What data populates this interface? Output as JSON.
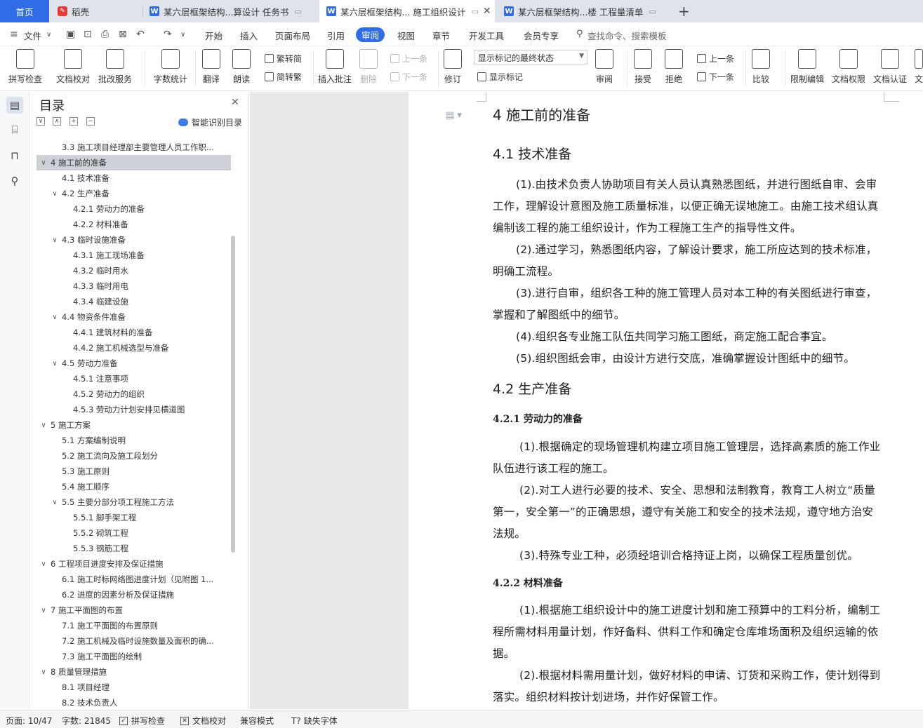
{
  "tabs": {
    "home": "首页",
    "daoke": "稻壳",
    "doc1": "某六层框架结构...算设计 任务书",
    "doc2": "某六层框架结构... 施工组织设计",
    "doc3": "某六层框架结构...楼 工程量清单"
  },
  "menu": {
    "file": "文件",
    "items": [
      "开始",
      "插入",
      "页面布局",
      "引用",
      "审阅",
      "视图",
      "章节",
      "开发工具",
      "会员专享"
    ],
    "active": "审阅",
    "search": "查找命令、搜索模板"
  },
  "ribbon": {
    "spell": "拼写检查",
    "doccheck": "文档校对",
    "batch": "批改服务",
    "wordcount": "字数统计",
    "translate": "翻译",
    "read": "朗读",
    "trad": "繁转简",
    "simp": "简转繁",
    "insert_comment": "插入批注",
    "delete": "删除",
    "prev": "上一条",
    "next": "下一条",
    "track": "修订",
    "markup_select": "显示标记的最终状态",
    "show_markup": "显示标记",
    "review": "审阅",
    "accept": "接受",
    "reject": "拒绝",
    "prev2": "上一条",
    "next2": "下一条",
    "compare": "比较",
    "restrict": "限制编辑",
    "permission": "文档权限",
    "certify": "文档认证",
    "cut": "文"
  },
  "toc": {
    "title": "目录",
    "smart": "智能识别目录",
    "items": [
      {
        "label": "3.3  施工项目经理部主要管理人员工作职...",
        "level": 2,
        "arrow": ""
      },
      {
        "label": "4 施工前的准备",
        "level": 1,
        "arrow": "v",
        "selected": true
      },
      {
        "label": "4.1 技术准备",
        "level": 2,
        "arrow": ""
      },
      {
        "label": "4.2 生产准备",
        "level": 2,
        "arrow": "v"
      },
      {
        "label": "4.2.1 劳动力的准备",
        "level": 3,
        "arrow": ""
      },
      {
        "label": "4.2.2 材料准备",
        "level": 3,
        "arrow": ""
      },
      {
        "label": "4.3  临时设施准备",
        "level": 2,
        "arrow": "v"
      },
      {
        "label": "4.3.1 施工现场准备",
        "level": 3,
        "arrow": ""
      },
      {
        "label": "4.3.2 临时用水",
        "level": 3,
        "arrow": ""
      },
      {
        "label": "4.3.3  临时用电",
        "level": 3,
        "arrow": ""
      },
      {
        "label": "4.3.4 临建设施",
        "level": 3,
        "arrow": ""
      },
      {
        "label": "4.4 物资条件准备",
        "level": 2,
        "arrow": "v"
      },
      {
        "label": "4.4.1  建筑材料的准备",
        "level": 3,
        "arrow": ""
      },
      {
        "label": "4.4.2 施工机械选型与准备",
        "level": 3,
        "arrow": ""
      },
      {
        "label": "4.5 劳动力准备",
        "level": 2,
        "arrow": "v"
      },
      {
        "label": "4.5.1  注意事项",
        "level": 3,
        "arrow": ""
      },
      {
        "label": "4.5.2 劳动力的组织",
        "level": 3,
        "arrow": ""
      },
      {
        "label": "4.5.3  劳动力计划安排见横道图",
        "level": 3,
        "arrow": ""
      },
      {
        "label": "5 施工方案",
        "level": 1,
        "arrow": "v"
      },
      {
        "label": "5.1  方案编制说明",
        "level": 2,
        "arrow": ""
      },
      {
        "label": "5.2 施工流向及施工段划分",
        "level": 2,
        "arrow": ""
      },
      {
        "label": "5.3 施工原则",
        "level": 2,
        "arrow": ""
      },
      {
        "label": "5.4  施工顺序",
        "level": 2,
        "arrow": ""
      },
      {
        "label": "5.5 主要分部分项工程施工方法",
        "level": 2,
        "arrow": "v"
      },
      {
        "label": "5.5.1 脚手架工程",
        "level": 3,
        "arrow": ""
      },
      {
        "label": "5.5.2 砌筑工程",
        "level": 3,
        "arrow": ""
      },
      {
        "label": "5.5.3 钢筋工程",
        "level": 3,
        "arrow": ""
      },
      {
        "label": "6 工程项目进度安排及保证措施",
        "level": 1,
        "arrow": "v"
      },
      {
        "label": "6.1 施工时标网络图进度计划（见附图  1...",
        "level": 2,
        "arrow": ""
      },
      {
        "label": "6.2 进度的因素分析及保证措施",
        "level": 2,
        "arrow": ""
      },
      {
        "label": "7 施工平面图的布置",
        "level": 1,
        "arrow": "v"
      },
      {
        "label": "7.1 施工平面图的布置原则",
        "level": 2,
        "arrow": ""
      },
      {
        "label": "7.2 施工机械及临时设施数量及面积的确...",
        "level": 2,
        "arrow": ""
      },
      {
        "label": "7.3 施工平面图的绘制",
        "level": 2,
        "arrow": ""
      },
      {
        "label": "8 质量管理措施",
        "level": 1,
        "arrow": "v"
      },
      {
        "label": "8.1 项目经理",
        "level": 2,
        "arrow": ""
      },
      {
        "label": "8.2 技术负责人",
        "level": 2,
        "arrow": ""
      }
    ]
  },
  "doc": {
    "h_4": "4 施工前的准备",
    "h_4_1": "4.1 技术准备",
    "p1a": "(1).由技术负责人协助项目有关人员认真熟悉图纸，并进行图纸自审、会审",
    "p1b": "工作，理解设计意图及施工质量标准，以便正确无误地施工。由施工技术组认真",
    "p1c": "编制该工程的施工组织设计，作为工程施工生产的指导性文件。",
    "p2a": "(2).通过学习，熟悉图纸内容，了解设计要求，施工所应达到的技术标准，",
    "p2b": "明确工流程。",
    "p3a": "(3).进行自审，组织各工种的施工管理人员对本工种的有关图纸进行审查，",
    "p3b": "掌握和了解图纸中的细节。",
    "p4": "(4).组织各专业施工队伍共同学习施工图纸，商定施工配合事宜。",
    "p5": "(5).组织图纸会审，由设计方进行交底，准确掌握设计图纸中的细节。",
    "h_4_2": "4.2 生产准备",
    "h_4_2_1": "4.2.1 劳动力的准备",
    "q1a": "(1).根据确定的现场管理机构建立项目施工管理层，选择高素质的施工作业",
    "q1b": "队伍进行该工程的施工。",
    "q2a": "(2).对工人进行必要的技术、安全、思想和法制教育，教育工人树立“质量",
    "q2b": "第一，安全第一”的正确思想，遵守有关施工和安全的技术法规，遵守地方治安",
    "q2c": "法规。",
    "q3": "(3).特殊专业工种，必须经培训合格持证上岗，以确保工程质量创优。",
    "h_4_2_2": "4.2.2 材料准备",
    "r1a": "(1).根据施工组织设计中的施工进度计划和施工预算中的工料分析，编制工",
    "r1b": "程所需材料用量计划，作好备料、供料工作和确定仓库堆场面积及组织运输的依",
    "r1c": "据。",
    "r2a": "(2).根据材料需用量计划，做好材料的申请、订货和采购工作，使计划得到",
    "r2b": "落实。组织材料按计划进场，并作好保管工作。"
  },
  "status": {
    "page": "页面: 10/47",
    "words": "字数: 21845",
    "spell": "拼写检查",
    "doccheck": "文档校对",
    "compat": "兼容模式",
    "missing_font": "缺失字体"
  }
}
